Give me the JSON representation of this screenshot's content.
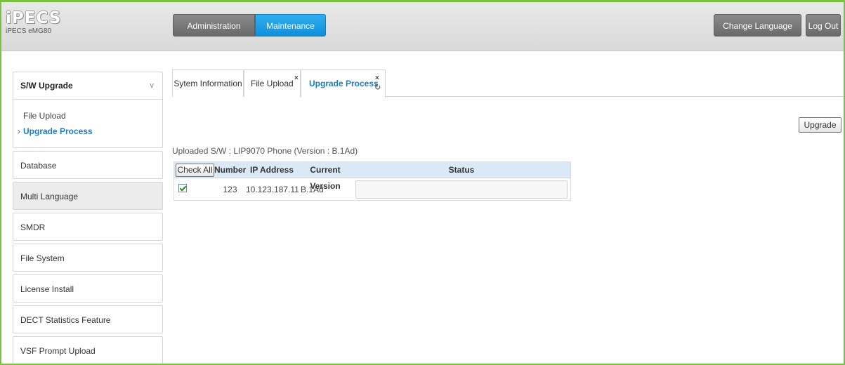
{
  "brand": {
    "logo_text": "iPECS",
    "model": "iPECS eMG80"
  },
  "top_nav": {
    "tabs": [
      {
        "label": "Administration",
        "active": false
      },
      {
        "label": "Maintenance",
        "active": true
      }
    ],
    "change_language": "Change Language",
    "logout": "Log Out"
  },
  "sidebar": {
    "group": {
      "title": "S/W Upgrade",
      "chevron": "v",
      "items": [
        {
          "label": "File Upload",
          "active": false
        },
        {
          "label": "Upgrade Process",
          "active": true
        }
      ]
    },
    "items": [
      {
        "label": "Database"
      },
      {
        "label": "Multi Language"
      },
      {
        "label": "SMDR"
      },
      {
        "label": "File System"
      },
      {
        "label": "License Install"
      },
      {
        "label": "DECT Statistics Feature"
      },
      {
        "label": "VSF Prompt Upload"
      }
    ]
  },
  "content_tabs": [
    {
      "label": "Sytem Information",
      "closable": false
    },
    {
      "label": "File Upload",
      "closable": true
    },
    {
      "label": "Upgrade Process",
      "closable": true,
      "active": true
    }
  ],
  "actions": {
    "upgrade": "Upgrade"
  },
  "uploaded_info": "Uploaded S/W : LIP9070 Phone (Version : B.1Ad)",
  "table": {
    "headers": {
      "check_all": "Check All",
      "number": "Number",
      "ip_address": "IP Address",
      "current_version": "Current Version",
      "status": "Status"
    },
    "rows": [
      {
        "checked": true,
        "number": "123",
        "ip_address": "10.123.187.11",
        "current_version": "B.1Ad",
        "status": ""
      }
    ]
  },
  "colors": {
    "accent_blue": "#1a7dc8",
    "maintenance_tab": "#1d9be6",
    "frame_green": "#7ac143",
    "table_header": "#dbe8f5"
  }
}
